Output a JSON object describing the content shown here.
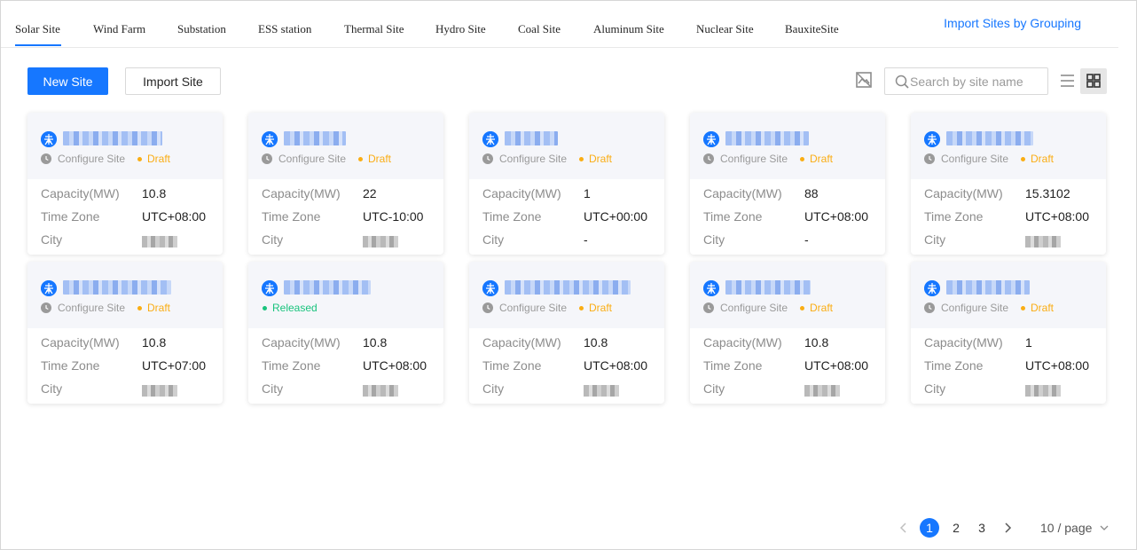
{
  "tabs": [
    {
      "label": "Solar Site",
      "active": true
    },
    {
      "label": "Wind Farm"
    },
    {
      "label": "Substation"
    },
    {
      "label": "ESS station"
    },
    {
      "label": "Thermal Site"
    },
    {
      "label": "Hydro Site"
    },
    {
      "label": "Coal Site"
    },
    {
      "label": "Aluminum Site"
    },
    {
      "label": "Nuclear Site"
    },
    {
      "label": "BauxiteSite"
    }
  ],
  "header": {
    "import_grouping_label": "Import Sites by Grouping"
  },
  "toolbar": {
    "new_site_label": "New Site",
    "import_site_label": "Import Site",
    "search_placeholder": "Search by site name",
    "view_mode": "grid"
  },
  "card_labels": {
    "configure": "Configure Site",
    "capacity": "Capacity(MW)",
    "time_zone": "Time Zone",
    "city": "City"
  },
  "sites": [
    {
      "status": "Draft",
      "configure": true,
      "capacity": "10.8",
      "time_zone": "UTC+08:00",
      "city": null
    },
    {
      "status": "Draft",
      "configure": true,
      "capacity": "22",
      "time_zone": "UTC-10:00",
      "city": null
    },
    {
      "status": "Draft",
      "configure": true,
      "capacity": "1",
      "time_zone": "UTC+00:00",
      "city": "-"
    },
    {
      "status": "Draft",
      "configure": true,
      "capacity": "88",
      "time_zone": "UTC+08:00",
      "city": "-"
    },
    {
      "status": "Draft",
      "configure": true,
      "capacity": "15.3102",
      "time_zone": "UTC+08:00",
      "city": null
    },
    {
      "status": "Draft",
      "configure": true,
      "capacity": "10.8",
      "time_zone": "UTC+07:00",
      "city": null
    },
    {
      "status": "Released",
      "configure": false,
      "capacity": "10.8",
      "time_zone": "UTC+08:00",
      "city": null
    },
    {
      "status": "Draft",
      "configure": true,
      "capacity": "10.8",
      "time_zone": "UTC+08:00",
      "city": null
    },
    {
      "status": "Draft",
      "configure": true,
      "capacity": "10.8",
      "time_zone": "UTC+08:00",
      "city": null
    },
    {
      "status": "Draft",
      "configure": true,
      "capacity": "1",
      "time_zone": "UTC+08:00",
      "city": null
    }
  ],
  "colors": {
    "accent": "#1677ff",
    "draft": "#faad14",
    "released": "#19c37d"
  },
  "pagination": {
    "pages": [
      "1",
      "2",
      "3"
    ],
    "current": "1",
    "page_size_label": "10 / page"
  }
}
